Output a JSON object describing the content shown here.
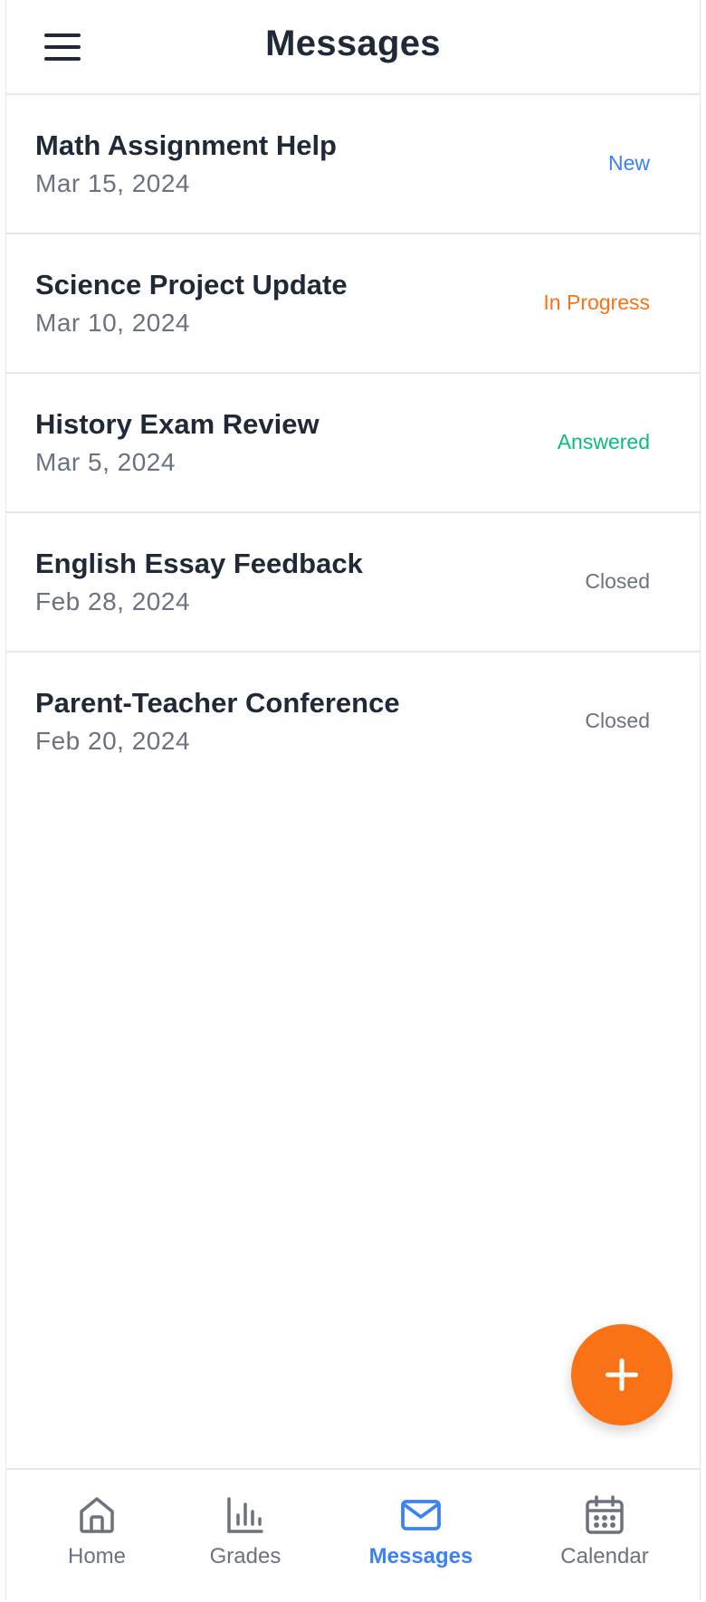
{
  "header": {
    "title": "Messages",
    "menu_icon": "hamburger-menu-icon"
  },
  "messages": [
    {
      "title": "Math Assignment Help",
      "date": "Mar 15, 2024",
      "status": "New",
      "status_color": "#3b82f6"
    },
    {
      "title": "Science Project Update",
      "date": "Mar 10, 2024",
      "status": "In Progress",
      "status_color": "#f97316"
    },
    {
      "title": "History Exam Review",
      "date": "Mar 5, 2024",
      "status": "Answered",
      "status_color": "#10b981"
    },
    {
      "title": "English Essay Feedback",
      "date": "Feb 28, 2024",
      "status": "Closed",
      "status_color": "#6b7280"
    },
    {
      "title": "Parent-Teacher Conference",
      "date": "Feb 20, 2024",
      "status": "Closed",
      "status_color": "#6b7280"
    }
  ],
  "fab": {
    "icon": "plus-icon",
    "color": "#f97316"
  },
  "nav": {
    "items": [
      {
        "label": "Home",
        "icon": "home-icon"
      },
      {
        "label": "Grades",
        "icon": "bar-chart-icon"
      },
      {
        "label": "Messages",
        "icon": "mail-icon",
        "active": true
      },
      {
        "label": "Calendar",
        "icon": "calendar-icon"
      }
    ],
    "active_color": "#3b82f6",
    "inactive_color": "#6b7280"
  }
}
